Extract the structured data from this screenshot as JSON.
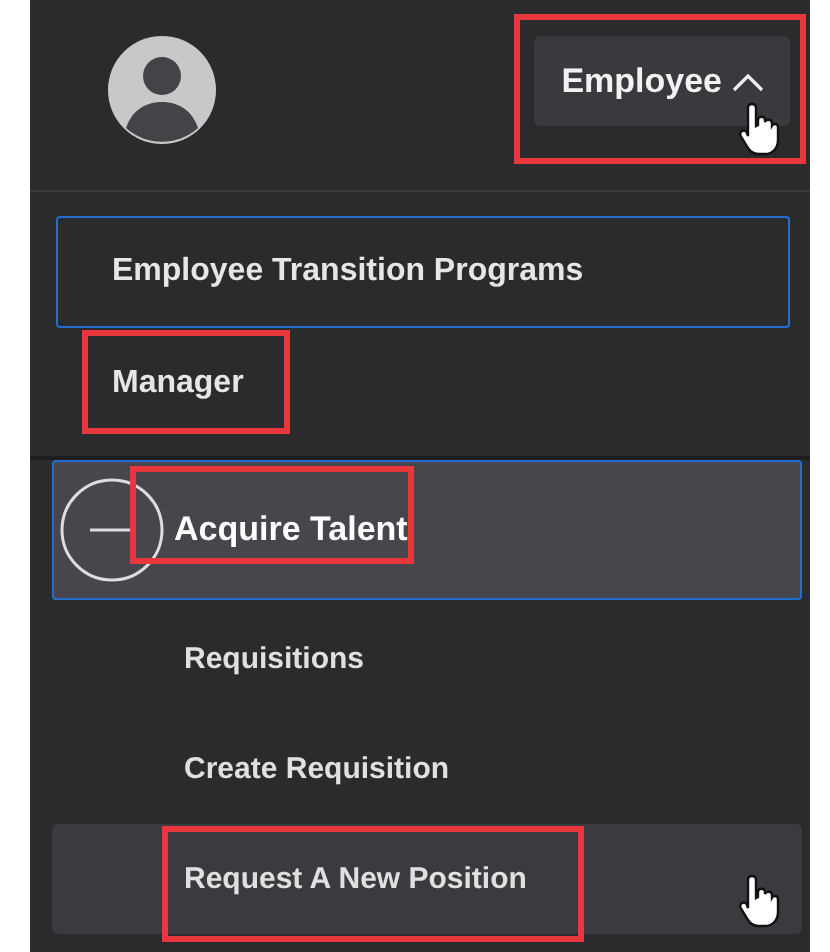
{
  "role_button": {
    "label": "Employee",
    "expanded": true,
    "highlighted": true,
    "hovered": true
  },
  "menu": [
    {
      "label": "Employee Transition Programs",
      "focused": true,
      "highlighted": false
    },
    {
      "label": "Manager",
      "focused": false,
      "highlighted": true
    }
  ],
  "group": {
    "label": "Acquire Talent",
    "expanded": true,
    "focused": true,
    "highlighted": true,
    "children": [
      {
        "label": "Requisitions",
        "hovered": false,
        "highlighted": false
      },
      {
        "label": "Create Requisition",
        "hovered": false,
        "highlighted": false
      },
      {
        "label": "Request A New Position",
        "hovered": true,
        "highlighted": true
      }
    ]
  }
}
